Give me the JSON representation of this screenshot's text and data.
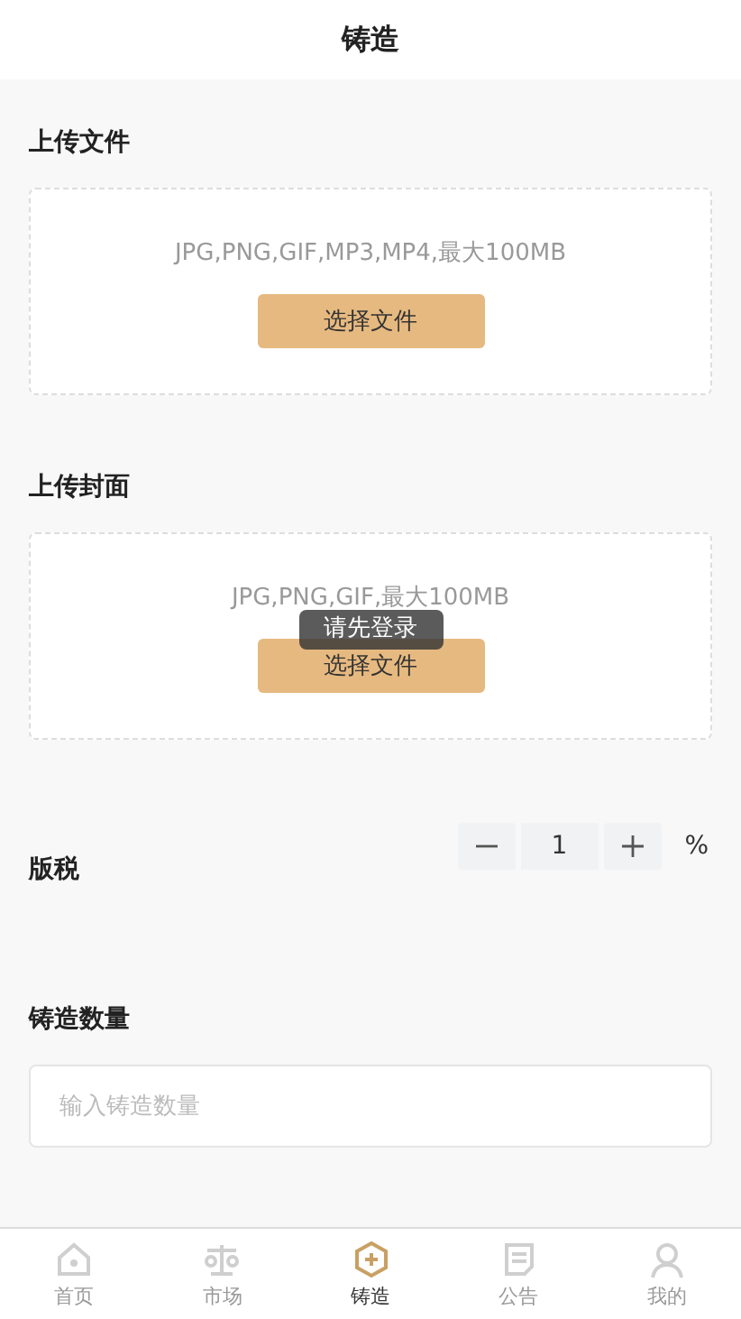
{
  "header": {
    "title": "铸造"
  },
  "upload_file": {
    "label": "上传文件",
    "hint": "JPG,PNG,GIF,MP3,MP4,最大100MB",
    "button": "选择文件"
  },
  "upload_cover": {
    "label": "上传封面",
    "hint": "JPG,PNG,GIF,最大100MB",
    "button": "选择文件"
  },
  "royalty": {
    "label": "版税",
    "value": "1",
    "unit": "%"
  },
  "quantity": {
    "label": "铸造数量",
    "placeholder": "输入铸造数量"
  },
  "toast": "请先登录",
  "tab_bar": [
    {
      "label": "首页",
      "selected": false
    },
    {
      "label": "市场",
      "selected": false
    },
    {
      "label": "铸造",
      "selected": true
    },
    {
      "label": "公告",
      "selected": false
    },
    {
      "label": "我的",
      "selected": false
    }
  ]
}
